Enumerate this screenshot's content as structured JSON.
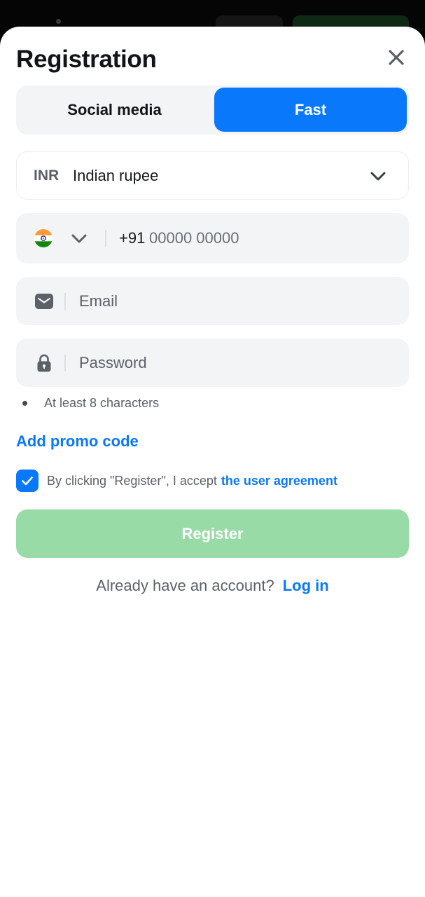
{
  "sheet": {
    "title": "Registration"
  },
  "tabs": [
    {
      "label": "Social media",
      "active": false
    },
    {
      "label": "Fast",
      "active": true
    }
  ],
  "currency": {
    "code": "INR",
    "name": "Indian rupee"
  },
  "phone": {
    "country_icon": "india-flag-icon",
    "prefix": "+91",
    "placeholder": "00000 00000",
    "value": ""
  },
  "email": {
    "placeholder": "Email",
    "value": "",
    "icon": "envelope-icon"
  },
  "password": {
    "placeholder": "Password",
    "value": "",
    "icon": "lock-icon",
    "hint": "At least 8 characters"
  },
  "promo": {
    "label": "Add promo code"
  },
  "agreement": {
    "checked": true,
    "text": "By clicking \"Register\", I accept",
    "link": "the user agreement"
  },
  "register": {
    "label": "Register"
  },
  "login": {
    "question": "Already have an account?",
    "link": "Log in"
  },
  "colors": {
    "accent": "#0a78fb",
    "register_disabled": "#99dba6",
    "field_bg": "#f3f4f5"
  }
}
